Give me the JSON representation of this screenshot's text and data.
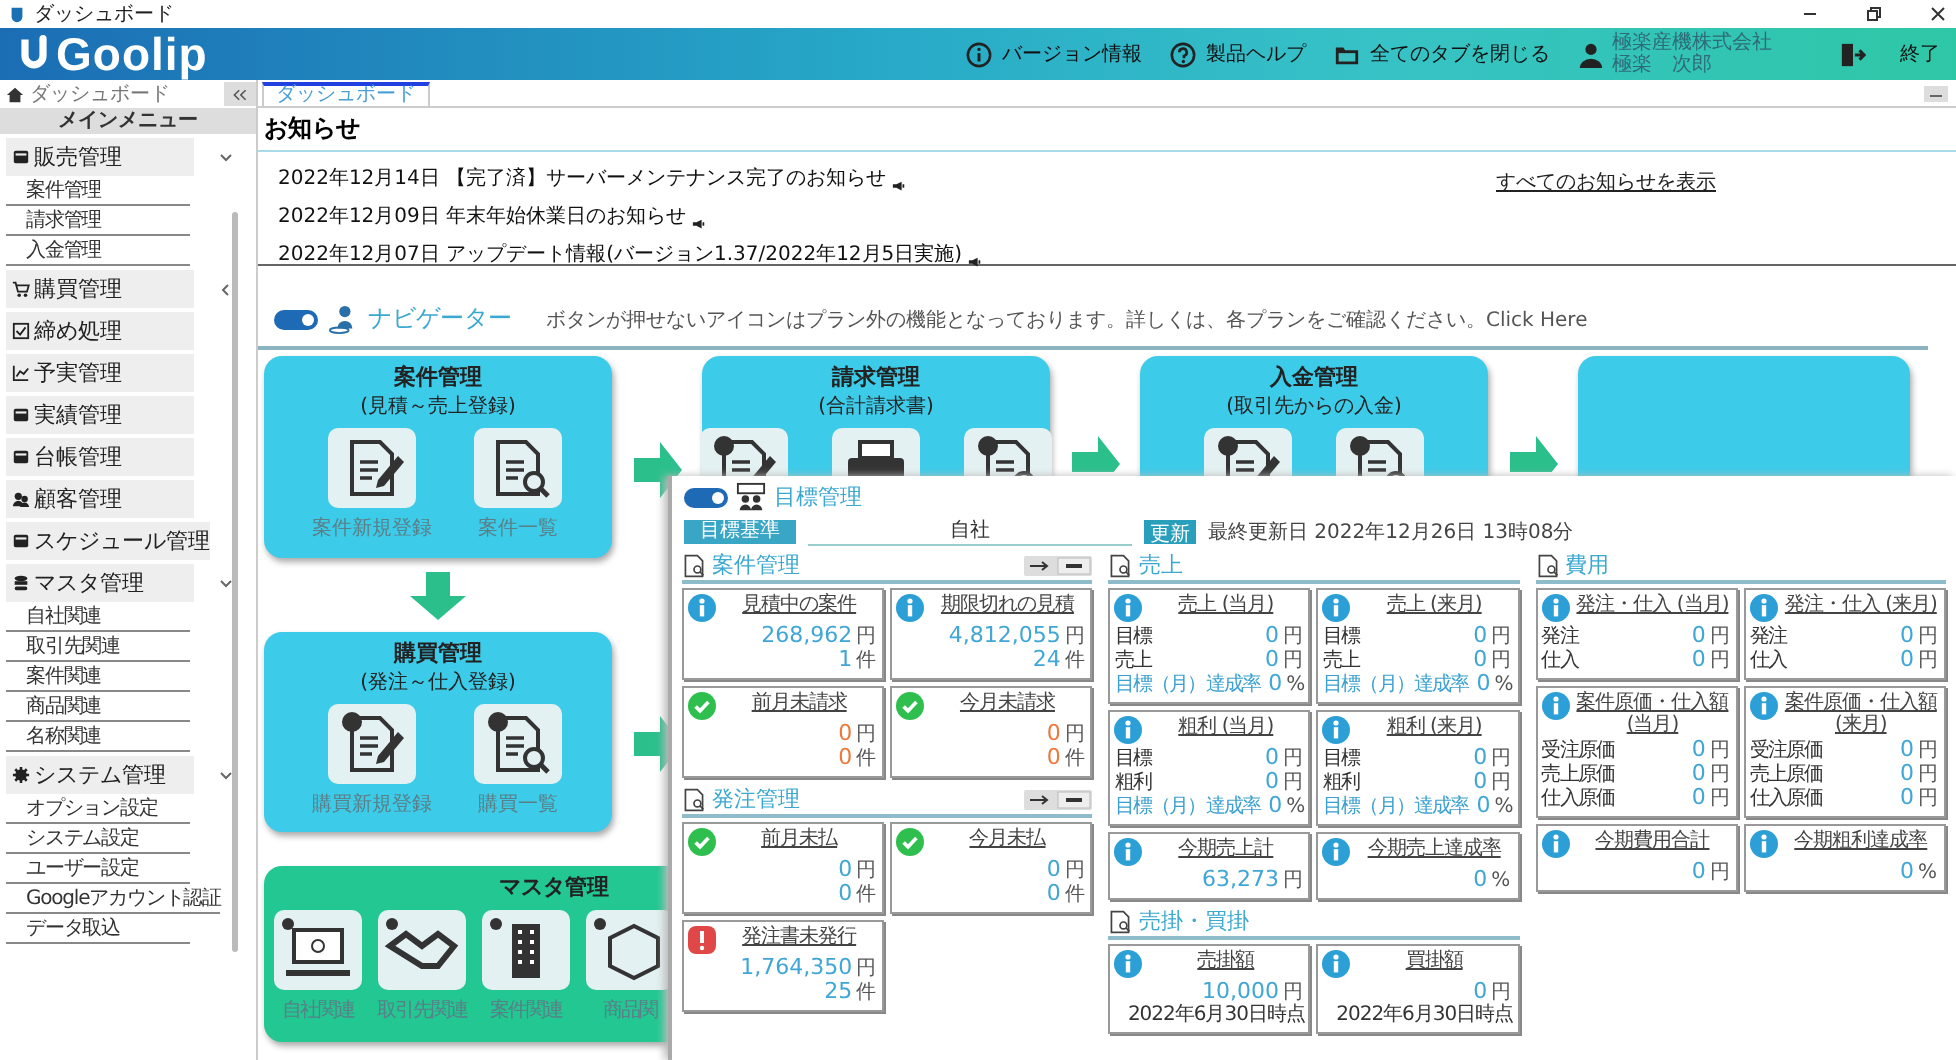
{
  "title_bar": {
    "title": "ダッシュボード"
  },
  "header": {
    "logo": "Goolip",
    "actions": [
      {
        "kind": "info",
        "label": "バージョン情報"
      },
      {
        "kind": "help",
        "label": "製品ヘルプ"
      },
      {
        "kind": "folder",
        "label": "全てのタブを閉じる"
      }
    ],
    "user": {
      "company": "極楽産機株式会社",
      "name": "極楽　次郎"
    },
    "exit": "終了"
  },
  "sidebar": {
    "home": "ダッシュボード",
    "menu_title": "メインメニュー",
    "items": [
      {
        "kind": "group",
        "label": "販売管理",
        "expanded": true,
        "children": [
          {
            "label": "案件管理"
          },
          {
            "label": "請求管理"
          },
          {
            "label": "入金管理"
          }
        ]
      },
      {
        "kind": "group",
        "label": "購買管理",
        "expanded": false
      },
      {
        "kind": "link",
        "label": "締め処理"
      },
      {
        "kind": "link",
        "label": "予実管理"
      },
      {
        "kind": "link",
        "label": "実績管理"
      },
      {
        "kind": "link",
        "label": "台帳管理"
      },
      {
        "kind": "link",
        "label": "顧客管理"
      },
      {
        "kind": "link",
        "label": "スケジュール管理"
      },
      {
        "kind": "group",
        "label": "マスタ管理",
        "expanded": true,
        "children": [
          {
            "label": "自社関連"
          },
          {
            "label": "取引先関連"
          },
          {
            "label": "案件関連"
          },
          {
            "label": "商品関連"
          },
          {
            "label": "名称関連"
          }
        ]
      },
      {
        "kind": "group",
        "label": "システム管理",
        "expanded": true,
        "children": [
          {
            "label": "オプション設定"
          },
          {
            "label": "システム設定"
          },
          {
            "label": "ユーザー設定"
          },
          {
            "label": "Googleアカウント認証"
          },
          {
            "label": "データ取込"
          }
        ]
      }
    ]
  },
  "tabs": [
    {
      "label": "ダッシュボード",
      "selected": true
    }
  ],
  "notices": {
    "title": "お知らせ",
    "items": [
      "2022年12月14日 【完了済】サーバーメンテナンス完了のお知らせ",
      "2022年12月09日 年末年始休業日のお知らせ",
      "2022年12月07日 アップデート情報(バージョン1.37/2022年12月5日実施)"
    ],
    "view_all": "すべてのお知らせを表示"
  },
  "navigator": {
    "on": true,
    "title": "ナビゲーター",
    "message": "ボタンが押せないアイコンはプラン外の機能となっております。詳しくは、各プランをご確認ください。Click Here"
  },
  "flow": {
    "row": [
      {
        "kind": "process",
        "title": "案件管理",
        "subtitle": "(見積～売上登録)",
        "items": [
          {
            "kind": "doc-new",
            "label": "案件新規登録"
          },
          {
            "kind": "doc-search",
            "label": "案件一覧"
          }
        ]
      },
      {
        "kind": "process",
        "title": "請求管理",
        "subtitle": "(合計請求書)",
        "items": [
          {
            "kind": "yen-new"
          },
          {
            "kind": "printer"
          },
          {
            "kind": "yen-search"
          }
        ]
      },
      {
        "kind": "process",
        "title": "入金管理",
        "subtitle": "(取引先からの入金)",
        "items": [
          {
            "kind": "coin-new"
          },
          {
            "kind": "coin-search"
          }
        ]
      },
      {
        "kind": "process"
      }
    ],
    "purchase": {
      "kind": "process",
      "title": "購買管理",
      "subtitle": "(発注～仕入登録)",
      "items": [
        {
          "kind": "cart-new",
          "label": "購買新規登録"
        },
        {
          "kind": "cart-search",
          "label": "購買一覧"
        }
      ]
    },
    "master": {
      "kind": "master",
      "title": "マスタ管理",
      "items": [
        {
          "kind": "laptop",
          "label": "自社関連"
        },
        {
          "kind": "handshake",
          "label": "取引先関連"
        },
        {
          "kind": "building",
          "label": "案件関連"
        },
        {
          "kind": "box",
          "label": "商品関"
        }
      ]
    }
  },
  "dashboard": {
    "on": true,
    "title": "目標管理",
    "basis_label": "目標基準",
    "basis_value": "自社",
    "update": "更新",
    "last_updated": "最終更新日 2022年12月26日 13時08分",
    "columns": [
      {
        "sections": [
          {
            "title": "案件管理",
            "switch": true,
            "cards": [
              {
                "kind": "info",
                "title": "見積中の案件",
                "highlight": false,
                "rows": [
                  {
                    "value": "268,962",
                    "unit": "円"
                  },
                  {
                    "value": "1",
                    "unit": "件"
                  }
                ]
              },
              {
                "kind": "info",
                "title": "期限切れの見積",
                "highlight": false,
                "rows": [
                  {
                    "value": "4,812,055",
                    "unit": "円"
                  },
                  {
                    "value": "24",
                    "unit": "件"
                  }
                ]
              },
              {
                "kind": "check",
                "title": "前月未請求",
                "highlight": true,
                "rows": [
                  {
                    "value": "0",
                    "unit": "円"
                  },
                  {
                    "value": "0",
                    "unit": "件"
                  }
                ]
              },
              {
                "kind": "check",
                "title": "今月未請求",
                "highlight": true,
                "rows": [
                  {
                    "value": "0",
                    "unit": "円"
                  },
                  {
                    "value": "0",
                    "unit": "件"
                  }
                ]
              }
            ]
          },
          {
            "title": "発注管理",
            "switch": true,
            "cards": [
              {
                "kind": "check",
                "title": "前月未払",
                "highlight": false,
                "rows": [
                  {
                    "value": "0",
                    "unit": "円"
                  },
                  {
                    "value": "0",
                    "unit": "件"
                  }
                ]
              },
              {
                "kind": "check",
                "title": "今月未払",
                "highlight": false,
                "rows": [
                  {
                    "value": "0",
                    "unit": "円"
                  },
                  {
                    "value": "0",
                    "unit": "件"
                  }
                ]
              },
              {
                "kind": "alert",
                "title": "発注書未発行",
                "highlight": false,
                "rows": [
                  {
                    "value": "1,764,350",
                    "unit": "円"
                  },
                  {
                    "value": "25",
                    "unit": "件"
                  }
                ]
              }
            ]
          }
        ]
      },
      {
        "sections": [
          {
            "title": "売上",
            "switch": false,
            "cards": [
              {
                "kind": "info",
                "title": "売上 (当月)",
                "highlight": false,
                "rows": [
                  {
                    "label": "目標",
                    "accent": false,
                    "value": "0",
                    "unit": "円"
                  },
                  {
                    "label": "売上",
                    "accent": false,
                    "value": "0",
                    "unit": "円"
                  },
                  {
                    "label": "目標（月）達成率",
                    "accent": true,
                    "value": "0",
                    "unit": "%"
                  }
                ]
              },
              {
                "kind": "info",
                "title": "売上 (来月)",
                "highlight": false,
                "rows": [
                  {
                    "label": "目標",
                    "accent": false,
                    "value": "0",
                    "unit": "円"
                  },
                  {
                    "label": "売上",
                    "accent": false,
                    "value": "0",
                    "unit": "円"
                  },
                  {
                    "label": "目標（月）達成率",
                    "accent": true,
                    "value": "0",
                    "unit": "%"
                  }
                ]
              },
              {
                "kind": "info",
                "title": "粗利 (当月)",
                "highlight": false,
                "rows": [
                  {
                    "label": "目標",
                    "accent": false,
                    "value": "0",
                    "unit": "円"
                  },
                  {
                    "label": "粗利",
                    "accent": false,
                    "value": "0",
                    "unit": "円"
                  },
                  {
                    "label": "目標（月）達成率",
                    "accent": true,
                    "value": "0",
                    "unit": "%"
                  }
                ]
              },
              {
                "kind": "info",
                "title": "粗利 (来月)",
                "highlight": false,
                "rows": [
                  {
                    "label": "目標",
                    "accent": false,
                    "value": "0",
                    "unit": "円"
                  },
                  {
                    "label": "粗利",
                    "accent": false,
                    "value": "0",
                    "unit": "円"
                  },
                  {
                    "label": "目標（月）達成率",
                    "accent": true,
                    "value": "0",
                    "unit": "%"
                  }
                ]
              },
              {
                "kind": "info",
                "title": "今期売上計",
                "highlight": false,
                "rows": [
                  {
                    "value": "63,273",
                    "unit": "円"
                  }
                ]
              },
              {
                "kind": "info",
                "title": "今期売上達成率",
                "highlight": false,
                "rows": [
                  {
                    "value": "0",
                    "unit": "%"
                  }
                ]
              }
            ]
          },
          {
            "title": "売掛・買掛",
            "switch": false,
            "cards": [
              {
                "kind": "info",
                "title": "売掛額",
                "highlight": false,
                "rows": [
                  {
                    "value": "10,000",
                    "unit": "円"
                  }
                ],
                "note": "2022年6月30日時点"
              },
              {
                "kind": "info",
                "title": "買掛額",
                "highlight": false,
                "rows": [
                  {
                    "value": "0",
                    "unit": "円"
                  }
                ],
                "note": "2022年6月30日時点"
              }
            ]
          }
        ]
      },
      {
        "sections": [
          {
            "title": "費用",
            "switch": false,
            "cards": [
              {
                "kind": "info",
                "title": "発注・仕入 (当月)",
                "highlight": false,
                "rows": [
                  {
                    "label": "発注",
                    "accent": false,
                    "value": "0",
                    "unit": "円"
                  },
                  {
                    "label": "仕入",
                    "accent": false,
                    "value": "0",
                    "unit": "円"
                  }
                ]
              },
              {
                "kind": "info",
                "title": "発注・仕入 (来月)",
                "highlight": false,
                "rows": [
                  {
                    "label": "発注",
                    "accent": false,
                    "value": "0",
                    "unit": "円"
                  },
                  {
                    "label": "仕入",
                    "accent": false,
                    "value": "0",
                    "unit": "円"
                  }
                ]
              },
              {
                "kind": "info",
                "title": "案件原価・仕入額 (当月)",
                "highlight": false,
                "rows": [
                  {
                    "label": "受注原価",
                    "accent": false,
                    "value": "0",
                    "unit": "円"
                  },
                  {
                    "label": "売上原価",
                    "accent": false,
                    "value": "0",
                    "unit": "円"
                  },
                  {
                    "label": "仕入原価",
                    "accent": false,
                    "value": "0",
                    "unit": "円"
                  }
                ]
              },
              {
                "kind": "info",
                "title": "案件原価・仕入額 (来月)",
                "highlight": false,
                "rows": [
                  {
                    "label": "受注原価",
                    "accent": false,
                    "value": "0",
                    "unit": "円"
                  },
                  {
                    "label": "売上原価",
                    "accent": false,
                    "value": "0",
                    "unit": "円"
                  },
                  {
                    "label": "仕入原価",
                    "accent": false,
                    "value": "0",
                    "unit": "円"
                  }
                ]
              },
              {
                "kind": "info",
                "title": "今期費用合計",
                "highlight": false,
                "rows": [
                  {
                    "value": "0",
                    "unit": "円"
                  }
                ]
              },
              {
                "kind": "info",
                "title": "今期粗利達成率",
                "highlight": false,
                "rows": [
                  {
                    "value": "0",
                    "unit": "%"
                  }
                ]
              }
            ]
          }
        ]
      }
    ]
  }
}
